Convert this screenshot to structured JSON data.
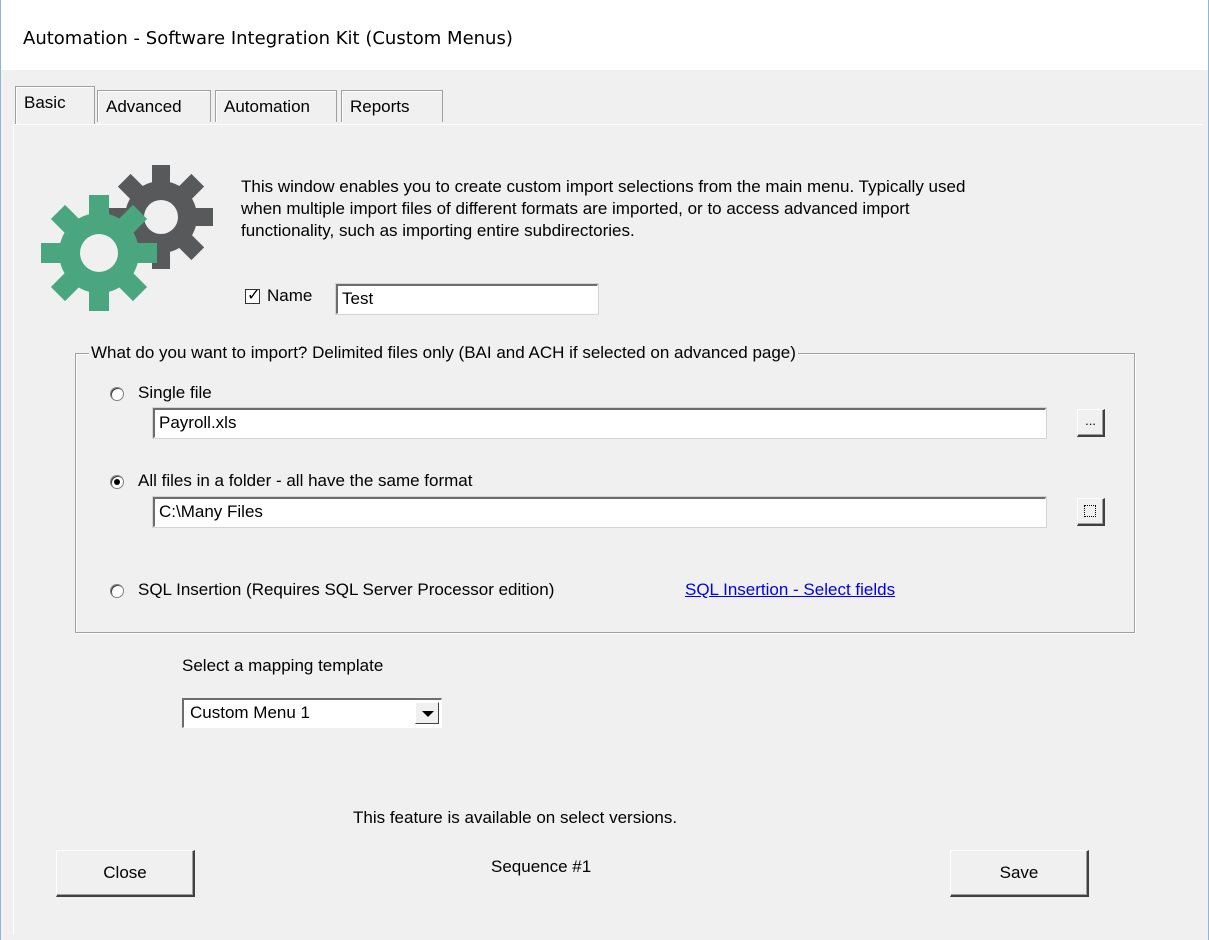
{
  "window": {
    "title": "Automation - Software Integration Kit (Custom Menus)"
  },
  "tabs": [
    {
      "label": "Basic",
      "active": true
    },
    {
      "label": "Advanced",
      "active": false
    },
    {
      "label": "Automation",
      "active": false
    },
    {
      "label": "Reports",
      "active": false
    }
  ],
  "intro": {
    "line1": "This window enables you to create custom import selections from the main menu.  Typically used",
    "line2": "when multiple import files of different formats are imported, or to access advanced import",
    "line3": "functionality, such as importing entire subdirectories.",
    "icon": "gears-icon",
    "colors": {
      "dark_gear": "#58595b",
      "green_gear": "#4aa67f"
    }
  },
  "name_field": {
    "checked": true,
    "label": "Name",
    "value": "Test"
  },
  "import_group": {
    "title": "What do you want to import?  Delimited files only (BAI and ACH if selected on advanced page)",
    "single_file": {
      "label": "Single file",
      "selected": false,
      "value": "Payroll.xls",
      "browse_label": "..."
    },
    "folder": {
      "label": "All files in a folder - all have the same format",
      "selected": true,
      "value": "C:\\Many Files"
    },
    "sql": {
      "label": "SQL Insertion (Requires SQL Server Processor edition)",
      "selected": false,
      "link": "SQL Insertion - Select fields"
    }
  },
  "mapping": {
    "label": "Select a mapping template",
    "selected": "Custom Menu 1"
  },
  "footer": {
    "notice": "This feature is available on select versions.",
    "sequence": "Sequence #1",
    "close_label": "Close",
    "save_label": "Save"
  }
}
